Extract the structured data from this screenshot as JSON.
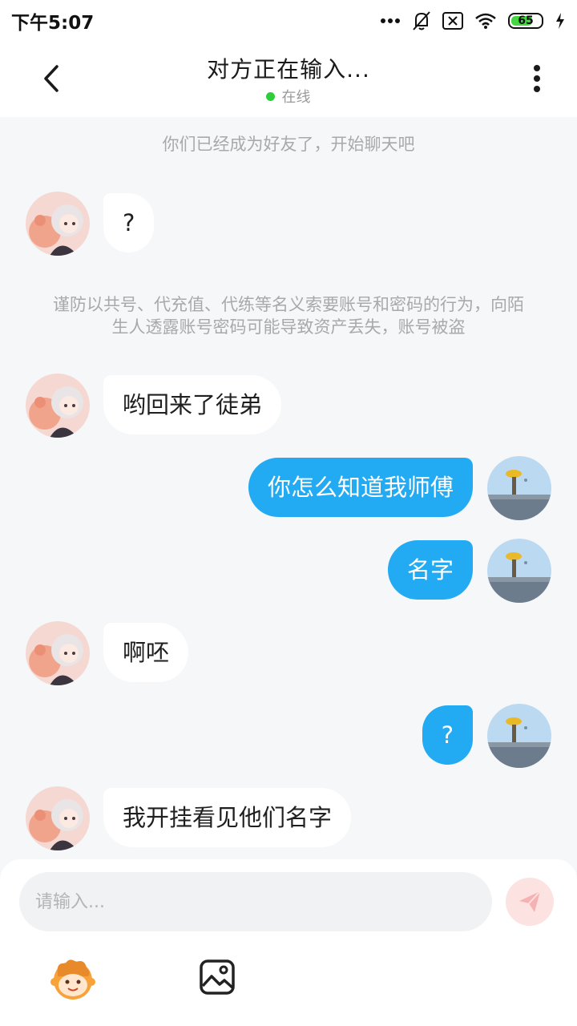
{
  "status_bar": {
    "time": "下午5:07",
    "battery": "65"
  },
  "header": {
    "title": "对方正在输入...",
    "status": "在线"
  },
  "messages": [
    {
      "type": "system",
      "text": "你们已经成为好友了，开始聊天吧"
    },
    {
      "type": "incoming",
      "text": "?"
    },
    {
      "type": "system",
      "text": "谨防以共号、代充值、代练等名义索要账号和密码的行为，向陌生人透露账号密码可能导致资产丢失，账号被盗"
    },
    {
      "type": "incoming",
      "text": "哟回来了徒弟"
    },
    {
      "type": "outgoing",
      "text": "你怎么知道我师傅"
    },
    {
      "type": "outgoing",
      "text": "名字"
    },
    {
      "type": "incoming",
      "text": "啊呸"
    },
    {
      "type": "outgoing",
      "text": "?"
    },
    {
      "type": "incoming",
      "text": "我开挂看见他们名字"
    }
  ],
  "composer": {
    "placeholder": "请输入..."
  },
  "colors": {
    "outgoing_bubble": "#22aaf3",
    "incoming_bubble": "#ffffff",
    "online": "#2fcc3b",
    "send_button": "#fde2e2"
  },
  "icons": [
    "back-icon",
    "more-icon",
    "mute-icon",
    "sim-icon",
    "wifi-icon",
    "charging-icon",
    "send-icon",
    "emoji-icon",
    "image-icon"
  ]
}
